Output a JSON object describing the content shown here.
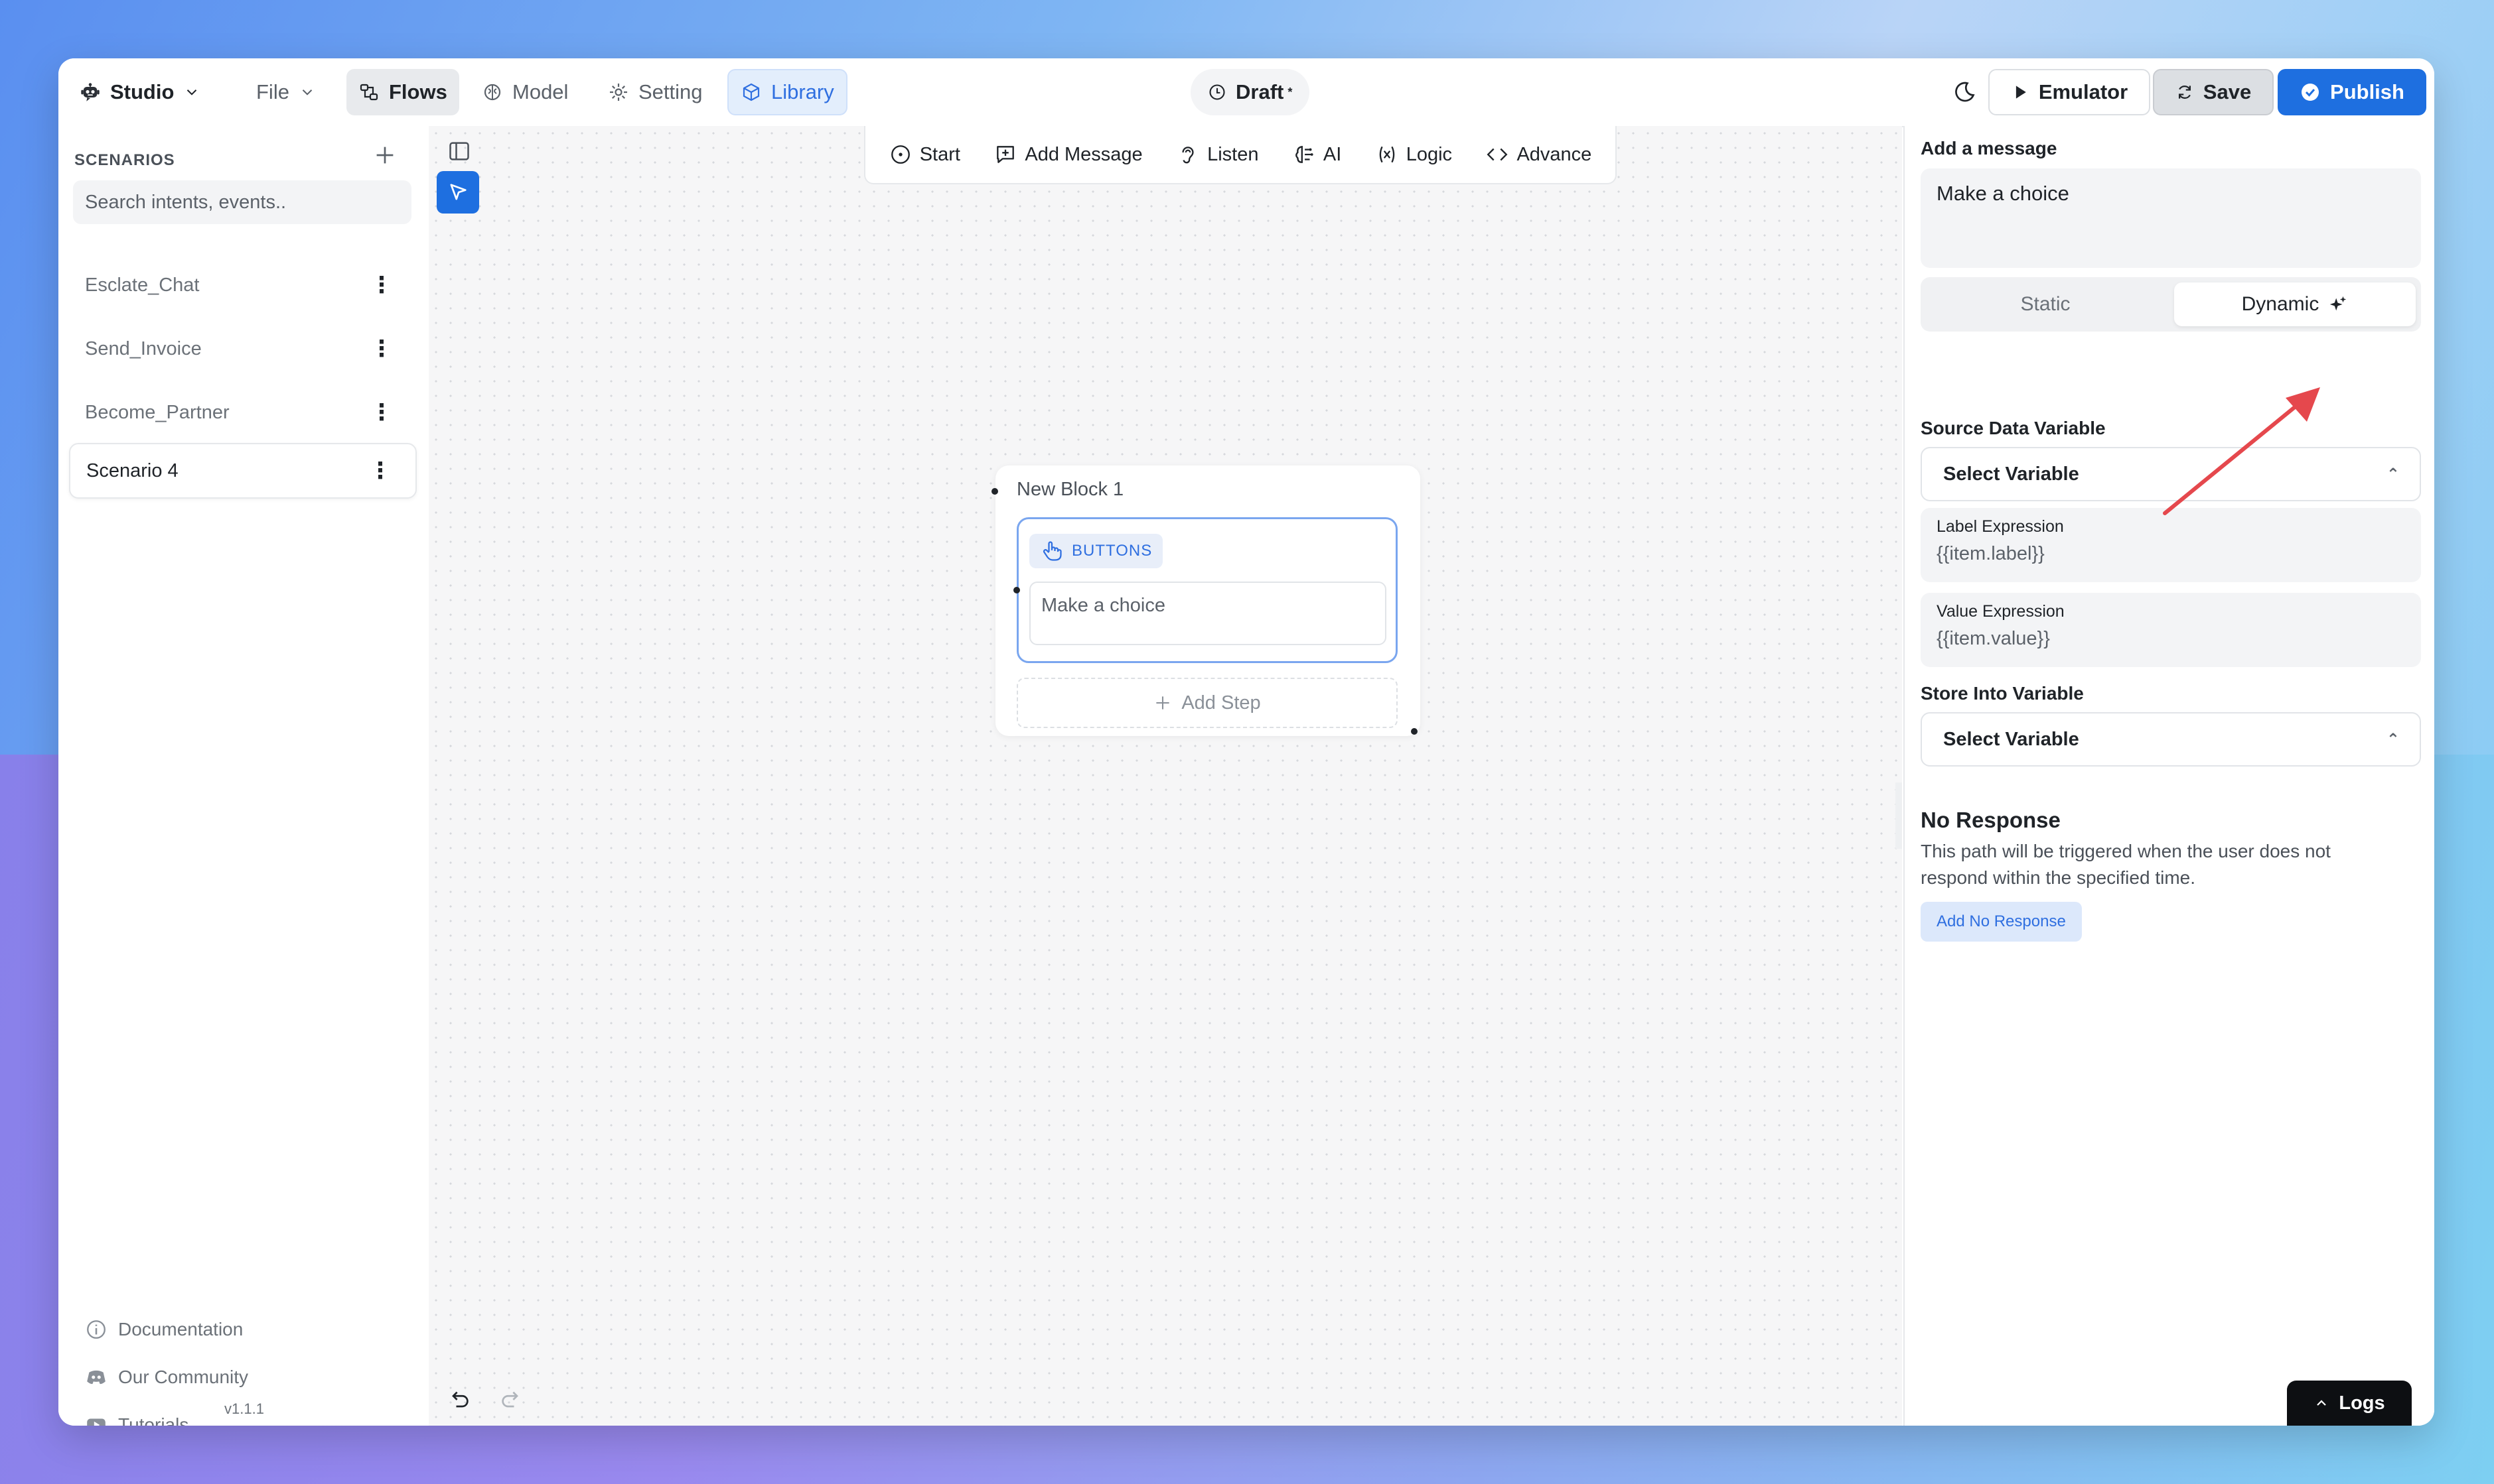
{
  "colors": {
    "accent": "#1e6fe0",
    "library": "#2f6fe0",
    "arrow": "#e5484d"
  },
  "topbar": {
    "app_name": "Studio",
    "file": "File",
    "flows": "Flows",
    "model": "Model",
    "setting": "Setting",
    "library": "Library",
    "status": "Draft",
    "status_mark": "*",
    "emulator": "Emulator",
    "save": "Save",
    "publish": "Publish"
  },
  "sidebar": {
    "heading": "SCENARIOS",
    "search_placeholder": "Search intents, events..",
    "scenarios": [
      {
        "label": "Esclate_Chat"
      },
      {
        "label": "Send_Invoice"
      },
      {
        "label": "Become_Partner"
      },
      {
        "label": "Scenario 4",
        "active": true
      }
    ],
    "footer": [
      {
        "label": "Documentation",
        "icon": "info-circle-icon"
      },
      {
        "label": "Our Community",
        "icon": "discord-icon"
      },
      {
        "label": "Tutorials",
        "icon": "youtube-icon"
      }
    ],
    "version": "v1.1.1"
  },
  "toolbar": {
    "start": "Start",
    "add_message": "Add Message",
    "listen": "Listen",
    "ai": "AI",
    "logic": "Logic",
    "advance": "Advance"
  },
  "block": {
    "title": "New Block 1",
    "step_tag": "BUTTONS",
    "step_message": "Make a choice",
    "add_step": "Add Step"
  },
  "panel": {
    "add_message_label": "Add a message",
    "message_value": "Make a choice",
    "seg_static": "Static",
    "seg_dynamic": "Dynamic",
    "source_label": "Source Data Variable",
    "source_value": "Select Variable",
    "label_expr_title": "Label Expression",
    "label_expr_value": "{{item.label}}",
    "value_expr_title": "Value Expression",
    "value_expr_value": "{{item.value}}",
    "store_label": "Store Into Variable",
    "store_value": "Select Variable",
    "no_response_title": "No Response",
    "no_response_desc": "This path will be triggered when the user does not respond within the specified time.",
    "add_no_response": "Add No Response",
    "logs": "Logs"
  }
}
